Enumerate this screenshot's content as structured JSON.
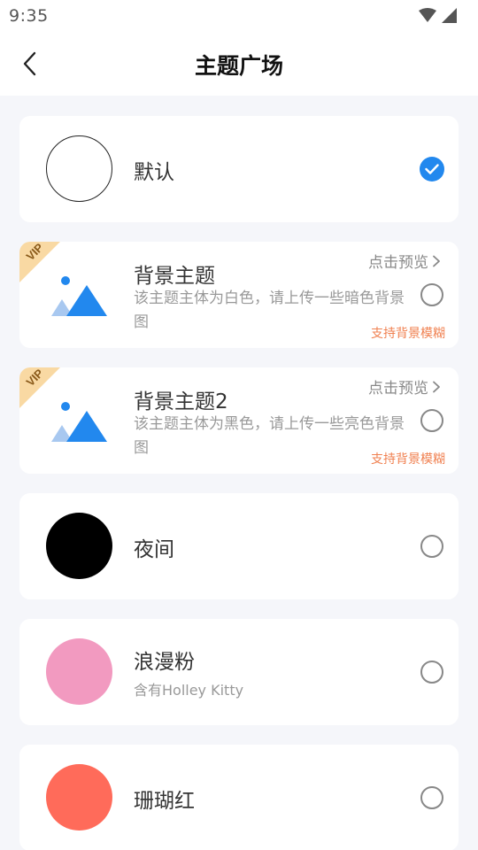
{
  "status_bar": {
    "time": "9:35"
  },
  "nav": {
    "title": "主题广场"
  },
  "themes": [
    {
      "title": "默认",
      "color": "#ffffff",
      "selected": true
    },
    {
      "title": "背景主题",
      "vip": "VIP",
      "desc": "该主题主体为白色，请上传一些暗色背景图",
      "preview": "点击预览",
      "tag": "支持背景模糊"
    },
    {
      "title": "背景主题2",
      "vip": "VIP",
      "desc": "该主题主体为黑色，请上传一些亮色背景图",
      "preview": "点击预览",
      "tag": "支持背景模糊"
    },
    {
      "title": "夜间",
      "color": "#000000"
    },
    {
      "title": "浪漫粉",
      "subtitle": "含有Holley Kitty",
      "color": "#f29ac0"
    },
    {
      "title": "珊瑚红",
      "color": "#ff6b5a"
    }
  ],
  "colors": {
    "accent": "#2288ee",
    "vip_ribbon": "#f9d9a3",
    "vip_text": "#8a5a1a",
    "tag": "#f08050",
    "icon_dark": "#2288ee",
    "icon_light": "#a8c8f0"
  },
  "icons": [
    "back-icon",
    "wifi-icon",
    "signal-icon",
    "check-icon",
    "image-icon",
    "chevron-right-icon"
  ]
}
